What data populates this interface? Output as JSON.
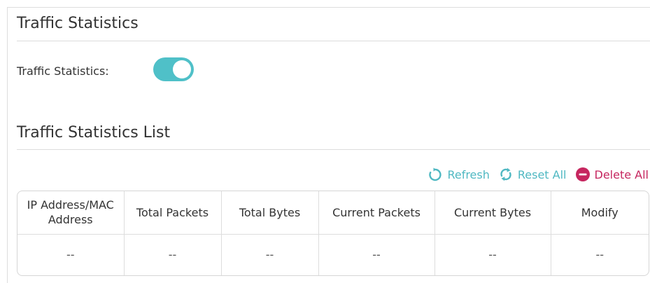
{
  "section_title": "Traffic Statistics",
  "toggle": {
    "label": "Traffic Statistics:",
    "state": "on",
    "color": "#4fc0c8"
  },
  "list_title": "Traffic Statistics List",
  "toolbar": {
    "refresh_label": "Refresh",
    "reset_all_label": "Reset All",
    "delete_all_label": "Delete All",
    "accent_color": "#4fb8c2",
    "delete_color": "#c6265f",
    "icons": [
      "refresh-icon",
      "reset-icon",
      "delete-icon"
    ]
  },
  "table": {
    "columns": [
      "IP Address/MAC Address",
      "Total Packets",
      "Total Bytes",
      "Current Packets",
      "Current Bytes",
      "Modify"
    ],
    "rows": [
      [
        "--",
        "--",
        "--",
        "--",
        "--",
        "--"
      ]
    ]
  }
}
